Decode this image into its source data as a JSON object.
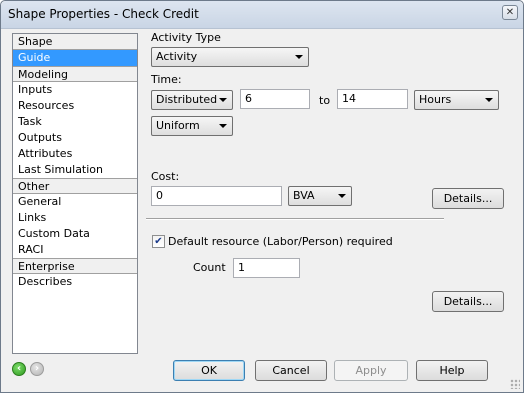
{
  "window": {
    "title": "Shape Properties - Check Credit"
  },
  "sidebar": {
    "groups": [
      {
        "label": "Shape",
        "items": [
          {
            "label": "Guide"
          }
        ]
      },
      {
        "label": "Modeling",
        "items": [
          {
            "label": "Inputs"
          },
          {
            "label": "Resources"
          },
          {
            "label": "Task"
          },
          {
            "label": "Outputs"
          },
          {
            "label": "Attributes"
          },
          {
            "label": "Last Simulation"
          }
        ]
      },
      {
        "label": "Other",
        "items": [
          {
            "label": "General"
          },
          {
            "label": "Links"
          },
          {
            "label": "Custom Data"
          },
          {
            "label": "RACI"
          }
        ]
      },
      {
        "label": "Enterprise",
        "items": [
          {
            "label": "Describes"
          }
        ]
      }
    ],
    "selected": "Guide"
  },
  "form": {
    "activity_type_label": "Activity Type",
    "activity_type_value": "Activity",
    "time_label": "Time:",
    "distribution_value": "Distributed",
    "time_from": "6",
    "to_label": "to",
    "time_to": "14",
    "time_unit": "Hours",
    "distribution_type": "Uniform",
    "cost_label": "Cost:",
    "cost_value": "0",
    "cost_type": "BVA",
    "details_label_1": "Details...",
    "default_resource_label": "Default resource (Labor/Person) required",
    "default_resource_checked": true,
    "count_label": "Count",
    "count_value": "1",
    "details_label_2": "Details..."
  },
  "footer": {
    "ok_label": "OK",
    "cancel_label": "Cancel",
    "apply_label": "Apply",
    "help_label": "Help"
  },
  "icons": {
    "back": "back-arrow-icon",
    "forward": "forward-arrow-icon",
    "close": "close-icon"
  },
  "colors": {
    "selection": "#3399ff",
    "nav_back": "#2e9a1f"
  }
}
